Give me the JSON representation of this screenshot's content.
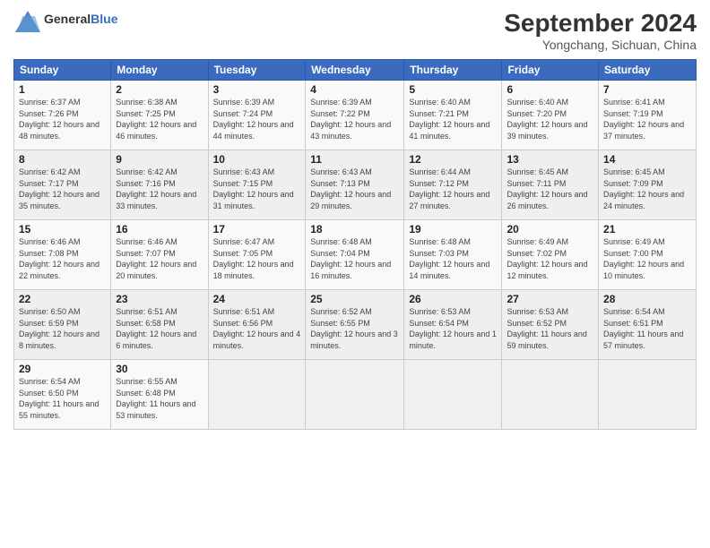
{
  "header": {
    "logo_general": "General",
    "logo_blue": "Blue",
    "month": "September 2024",
    "location": "Yongchang, Sichuan, China"
  },
  "weekdays": [
    "Sunday",
    "Monday",
    "Tuesday",
    "Wednesday",
    "Thursday",
    "Friday",
    "Saturday"
  ],
  "weeks": [
    [
      {
        "day": "1",
        "sunrise": "6:37 AM",
        "sunset": "7:26 PM",
        "daylight": "12 hours and 48 minutes."
      },
      {
        "day": "2",
        "sunrise": "6:38 AM",
        "sunset": "7:25 PM",
        "daylight": "12 hours and 46 minutes."
      },
      {
        "day": "3",
        "sunrise": "6:39 AM",
        "sunset": "7:24 PM",
        "daylight": "12 hours and 44 minutes."
      },
      {
        "day": "4",
        "sunrise": "6:39 AM",
        "sunset": "7:22 PM",
        "daylight": "12 hours and 43 minutes."
      },
      {
        "day": "5",
        "sunrise": "6:40 AM",
        "sunset": "7:21 PM",
        "daylight": "12 hours and 41 minutes."
      },
      {
        "day": "6",
        "sunrise": "6:40 AM",
        "sunset": "7:20 PM",
        "daylight": "12 hours and 39 minutes."
      },
      {
        "day": "7",
        "sunrise": "6:41 AM",
        "sunset": "7:19 PM",
        "daylight": "12 hours and 37 minutes."
      }
    ],
    [
      {
        "day": "8",
        "sunrise": "6:42 AM",
        "sunset": "7:17 PM",
        "daylight": "12 hours and 35 minutes."
      },
      {
        "day": "9",
        "sunrise": "6:42 AM",
        "sunset": "7:16 PM",
        "daylight": "12 hours and 33 minutes."
      },
      {
        "day": "10",
        "sunrise": "6:43 AM",
        "sunset": "7:15 PM",
        "daylight": "12 hours and 31 minutes."
      },
      {
        "day": "11",
        "sunrise": "6:43 AM",
        "sunset": "7:13 PM",
        "daylight": "12 hours and 29 minutes."
      },
      {
        "day": "12",
        "sunrise": "6:44 AM",
        "sunset": "7:12 PM",
        "daylight": "12 hours and 27 minutes."
      },
      {
        "day": "13",
        "sunrise": "6:45 AM",
        "sunset": "7:11 PM",
        "daylight": "12 hours and 26 minutes."
      },
      {
        "day": "14",
        "sunrise": "6:45 AM",
        "sunset": "7:09 PM",
        "daylight": "12 hours and 24 minutes."
      }
    ],
    [
      {
        "day": "15",
        "sunrise": "6:46 AM",
        "sunset": "7:08 PM",
        "daylight": "12 hours and 22 minutes."
      },
      {
        "day": "16",
        "sunrise": "6:46 AM",
        "sunset": "7:07 PM",
        "daylight": "12 hours and 20 minutes."
      },
      {
        "day": "17",
        "sunrise": "6:47 AM",
        "sunset": "7:05 PM",
        "daylight": "12 hours and 18 minutes."
      },
      {
        "day": "18",
        "sunrise": "6:48 AM",
        "sunset": "7:04 PM",
        "daylight": "12 hours and 16 minutes."
      },
      {
        "day": "19",
        "sunrise": "6:48 AM",
        "sunset": "7:03 PM",
        "daylight": "12 hours and 14 minutes."
      },
      {
        "day": "20",
        "sunrise": "6:49 AM",
        "sunset": "7:02 PM",
        "daylight": "12 hours and 12 minutes."
      },
      {
        "day": "21",
        "sunrise": "6:49 AM",
        "sunset": "7:00 PM",
        "daylight": "12 hours and 10 minutes."
      }
    ],
    [
      {
        "day": "22",
        "sunrise": "6:50 AM",
        "sunset": "6:59 PM",
        "daylight": "12 hours and 8 minutes."
      },
      {
        "day": "23",
        "sunrise": "6:51 AM",
        "sunset": "6:58 PM",
        "daylight": "12 hours and 6 minutes."
      },
      {
        "day": "24",
        "sunrise": "6:51 AM",
        "sunset": "6:56 PM",
        "daylight": "12 hours and 4 minutes."
      },
      {
        "day": "25",
        "sunrise": "6:52 AM",
        "sunset": "6:55 PM",
        "daylight": "12 hours and 3 minutes."
      },
      {
        "day": "26",
        "sunrise": "6:53 AM",
        "sunset": "6:54 PM",
        "daylight": "12 hours and 1 minute."
      },
      {
        "day": "27",
        "sunrise": "6:53 AM",
        "sunset": "6:52 PM",
        "daylight": "11 hours and 59 minutes."
      },
      {
        "day": "28",
        "sunrise": "6:54 AM",
        "sunset": "6:51 PM",
        "daylight": "11 hours and 57 minutes."
      }
    ],
    [
      {
        "day": "29",
        "sunrise": "6:54 AM",
        "sunset": "6:50 PM",
        "daylight": "11 hours and 55 minutes."
      },
      {
        "day": "30",
        "sunrise": "6:55 AM",
        "sunset": "6:48 PM",
        "daylight": "11 hours and 53 minutes."
      },
      null,
      null,
      null,
      null,
      null
    ]
  ]
}
